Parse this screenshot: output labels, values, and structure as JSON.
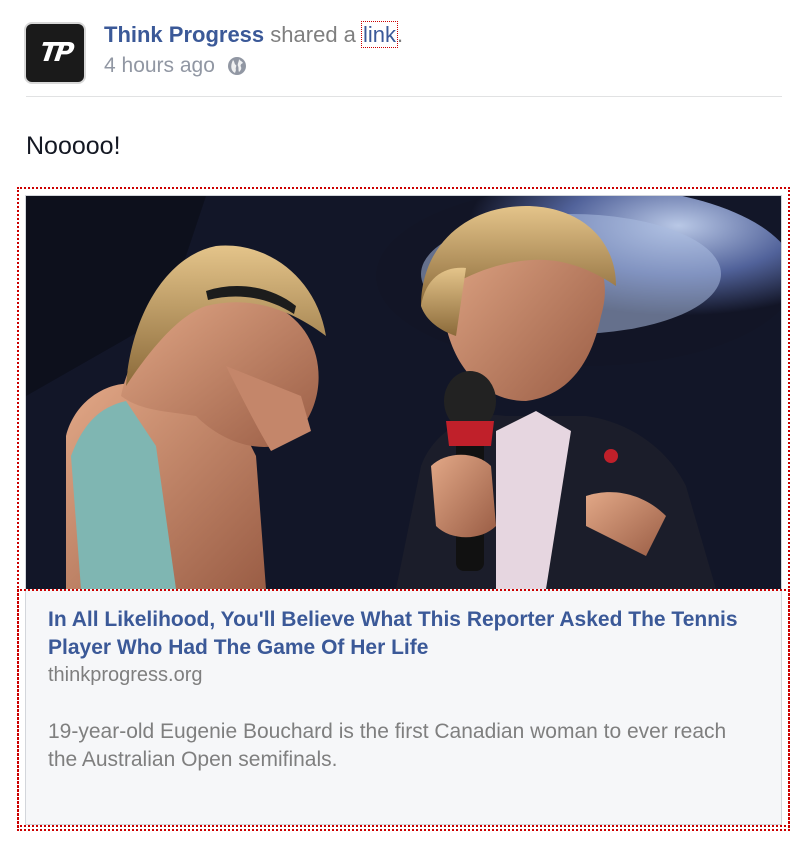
{
  "post": {
    "page_name": "Think Progress",
    "action": "shared a",
    "action_link": "link",
    "action_end": ".",
    "timestamp": "4 hours ago",
    "privacy_icon": "globe-icon",
    "avatar_text": "TP",
    "message": "Nooooo!"
  },
  "link_preview": {
    "title": "In All Likelihood, You'll Believe What This Reporter Asked The Tennis Player Who Had The Game Of Her Life",
    "domain": "thinkprogress.org",
    "description": "19-year-old Eugenie Bouchard is the first Canadian woman to ever reach the Australian Open semifinals.",
    "photo_icon": "reporter-interview-photo"
  },
  "colors": {
    "link_blue": "#3b5998",
    "muted_gray": "#7f7f7f",
    "preview_bg": "#f6f7f9",
    "highlight": "#cc0000"
  }
}
